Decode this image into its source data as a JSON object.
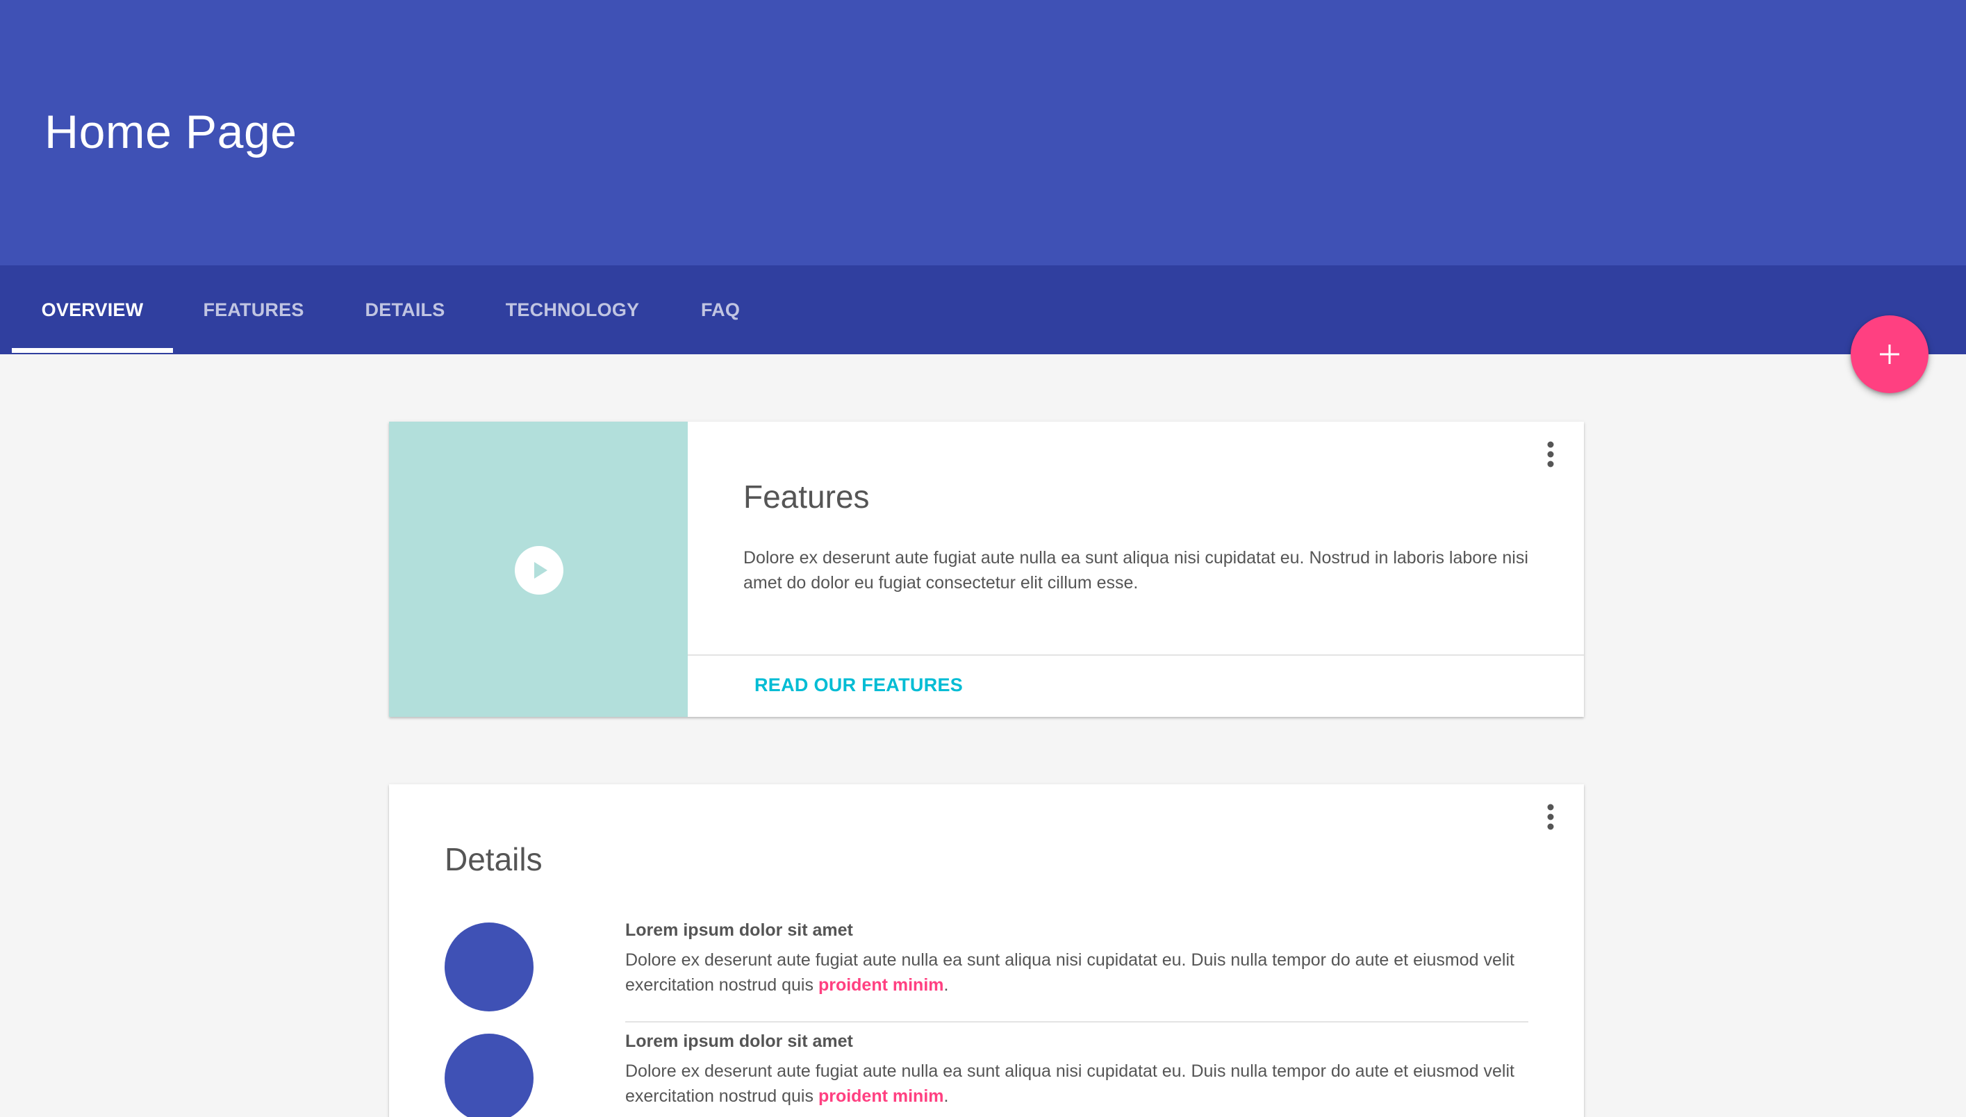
{
  "header": {
    "title": "Home Page",
    "color": "#3f51b5",
    "tabbar_color": "#303f9f"
  },
  "tabs": [
    {
      "label": "OVERVIEW",
      "active": true
    },
    {
      "label": "FEATURES",
      "active": false
    },
    {
      "label": "DETAILS",
      "active": false
    },
    {
      "label": "TECHNOLOGY",
      "active": false
    },
    {
      "label": "FAQ",
      "active": false
    }
  ],
  "fab": {
    "icon": "plus-icon",
    "color": "#ff4081"
  },
  "features_card": {
    "media_icon": "play-icon",
    "media_color": "#b2dfdb",
    "title": "Features",
    "text": "Dolore ex deserunt aute fugiat aute nulla ea sunt aliqua nisi cupidatat eu. Nostrud in laboris labore nisi amet do dolor eu fugiat consectetur elit cillum esse.",
    "action": "READ OUR FEATURES",
    "menu_icon": "more-vert-icon"
  },
  "details_card": {
    "title": "Details",
    "menu_icon": "more-vert-icon",
    "items": [
      {
        "title": "Lorem ipsum dolor sit amet",
        "text": "Dolore ex deserunt aute fugiat aute nulla ea sunt aliqua nisi cupidatat eu. Duis nulla tempor do aute et eiusmod velit exercitation nostrud quis ",
        "link": "proident minim",
        "suffix": "."
      },
      {
        "title": "Lorem ipsum dolor sit amet",
        "text": "Dolore ex deserunt aute fugiat aute nulla ea sunt aliqua nisi cupidatat eu. Duis nulla tempor do aute et eiusmod velit exercitation nostrud quis ",
        "link": "proident minim",
        "suffix": "."
      }
    ]
  },
  "colors": {
    "accent": "#ff4081",
    "action": "#00bcd4",
    "avatar": "#3f51b5"
  }
}
